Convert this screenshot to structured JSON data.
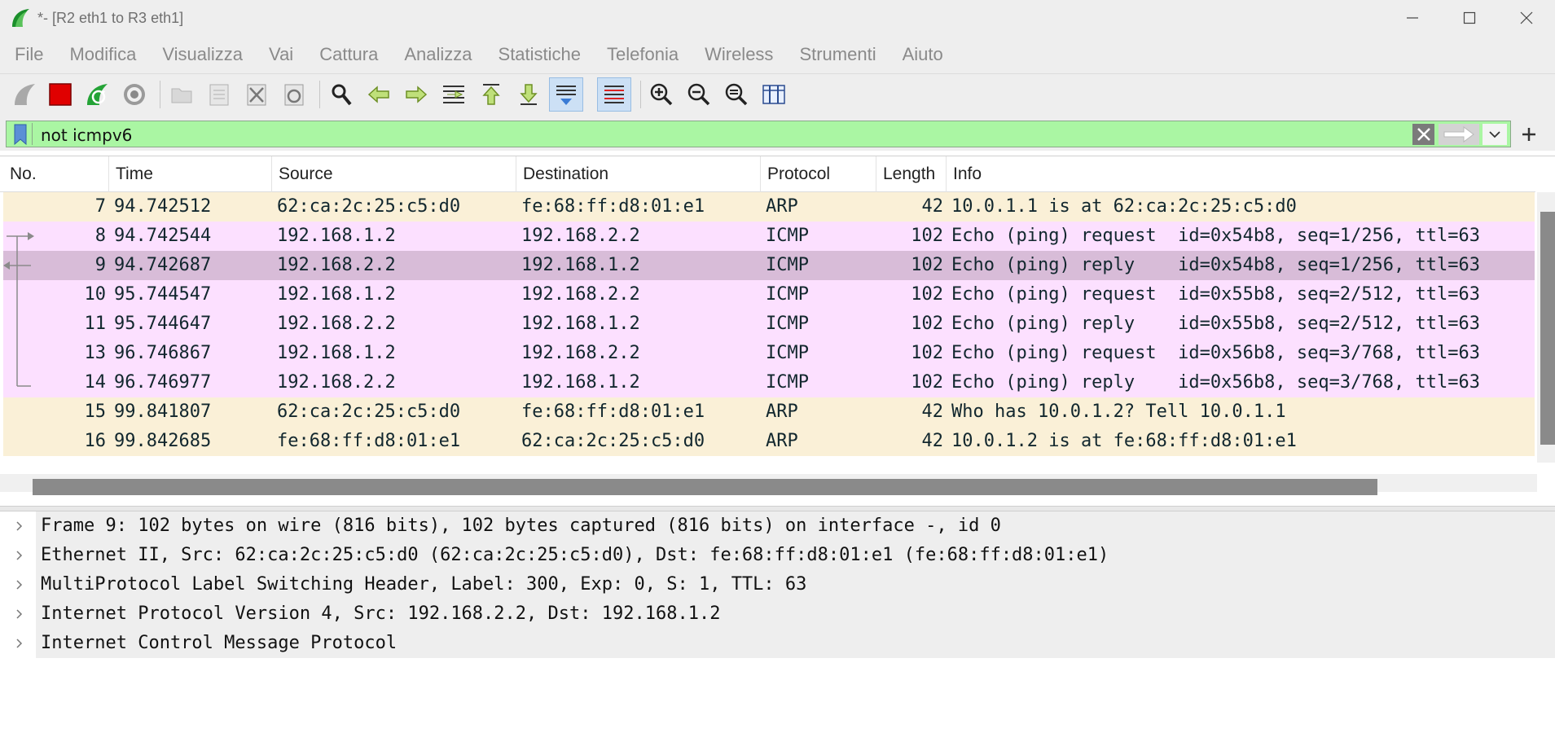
{
  "window": {
    "title": "*- [R2 eth1 to R3 eth1]",
    "controls": [
      "minimize-icon",
      "maximize-icon",
      "close-icon"
    ]
  },
  "menu": [
    "File",
    "Modifica",
    "Visualizza",
    "Vai",
    "Cattura",
    "Analizza",
    "Statistiche",
    "Telefonia",
    "Wireless",
    "Strumenti",
    "Aiuto"
  ],
  "toolbar": {
    "buttons": [
      "shark-fin-start-icon",
      "stop-capture-icon",
      "restart-capture-icon",
      "capture-options-icon",
      "open-file-icon",
      "save-file-icon",
      "close-file-icon",
      "reload-file-icon",
      "find-packet-icon",
      "go-back-icon",
      "go-forward-icon",
      "go-to-packet-icon",
      "first-packet-icon",
      "last-packet-icon",
      "auto-scroll-icon",
      "colorize-icon",
      "zoom-in-icon",
      "zoom-out-icon",
      "normal-size-icon",
      "resize-columns-icon"
    ],
    "active": [
      "auto-scroll-icon",
      "colorize-icon"
    ]
  },
  "filter": {
    "value": "not icmpv6",
    "background": "#aaf6a3"
  },
  "packet_list": {
    "columns": [
      "No.",
      "Time",
      "Source",
      "Destination",
      "Protocol",
      "Length",
      "Info"
    ],
    "rows": [
      {
        "no": "7",
        "time": "94.742512",
        "source": "62:ca:2c:25:c5:d0",
        "destination": "fe:68:ff:d8:01:e1",
        "protocol": "ARP",
        "length": "42",
        "info": "10.0.1.1 is at 62:ca:2c:25:c5:d0",
        "kind": "arp",
        "marker": ""
      },
      {
        "no": "8",
        "time": "94.742544",
        "source": "192.168.1.2",
        "destination": "192.168.2.2",
        "protocol": "ICMP",
        "length": "102",
        "info": "Echo (ping) request  id=0x54b8, seq=1/256, ttl=63",
        "kind": "icmp",
        "marker": "request-start"
      },
      {
        "no": "9",
        "time": "94.742687",
        "source": "192.168.2.2",
        "destination": "192.168.1.2",
        "protocol": "ICMP",
        "length": "102",
        "info": "Echo (ping) reply    id=0x54b8, seq=1/256, ttl=63",
        "kind": "selected",
        "marker": "reply-arrow"
      },
      {
        "no": "10",
        "time": "95.744547",
        "source": "192.168.1.2",
        "destination": "192.168.2.2",
        "protocol": "ICMP",
        "length": "102",
        "info": "Echo (ping) request  id=0x55b8, seq=2/512, ttl=63",
        "kind": "icmp",
        "marker": "line"
      },
      {
        "no": "11",
        "time": "95.744647",
        "source": "192.168.2.2",
        "destination": "192.168.1.2",
        "protocol": "ICMP",
        "length": "102",
        "info": "Echo (ping) reply    id=0x55b8, seq=2/512, ttl=63",
        "kind": "icmp",
        "marker": "line"
      },
      {
        "no": "13",
        "time": "96.746867",
        "source": "192.168.1.2",
        "destination": "192.168.2.2",
        "protocol": "ICMP",
        "length": "102",
        "info": "Echo (ping) request  id=0x56b8, seq=3/768, ttl=63",
        "kind": "icmp",
        "marker": "line"
      },
      {
        "no": "14",
        "time": "96.746977",
        "source": "192.168.2.2",
        "destination": "192.168.1.2",
        "protocol": "ICMP",
        "length": "102",
        "info": "Echo (ping) reply    id=0x56b8, seq=3/768, ttl=63",
        "kind": "icmp",
        "marker": "end"
      },
      {
        "no": "15",
        "time": "99.841807",
        "source": "62:ca:2c:25:c5:d0",
        "destination": "fe:68:ff:d8:01:e1",
        "protocol": "ARP",
        "length": "42",
        "info": "Who has 10.0.1.2? Tell 10.0.1.1",
        "kind": "arp",
        "marker": ""
      },
      {
        "no": "16",
        "time": "99.842685",
        "source": "fe:68:ff:d8:01:e1",
        "destination": "62:ca:2c:25:c5:d0",
        "protocol": "ARP",
        "length": "42",
        "info": "10.0.1.2 is at fe:68:ff:d8:01:e1",
        "kind": "arp",
        "marker": ""
      }
    ]
  },
  "details": [
    "Frame 9: 102 bytes on wire (816 bits), 102 bytes captured (816 bits) on interface -, id 0",
    "Ethernet II, Src: 62:ca:2c:25:c5:d0 (62:ca:2c:25:c5:d0), Dst: fe:68:ff:d8:01:e1 (fe:68:ff:d8:01:e1)",
    "MultiProtocol Label Switching Header, Label: 300, Exp: 0, S: 1, TTL: 63",
    "Internet Protocol Version 4, Src: 192.168.2.2, Dst: 192.168.1.2",
    "Internet Control Message Protocol"
  ],
  "colors": {
    "arp_row": "#faf0d7",
    "icmp_row": "#fce0ff",
    "selected_row": "#d8bcd8"
  }
}
